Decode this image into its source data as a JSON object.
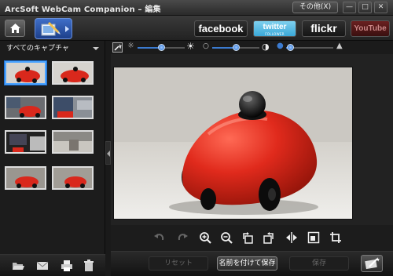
{
  "window": {
    "title": "ArcSoft WebCam Companion  –  編集",
    "other_button": "その他(X)",
    "minimize": "—",
    "maximize": "□",
    "close": "✕"
  },
  "toolbar": {
    "home_icon": "home-icon",
    "capture_icon": "capture-edit-icon",
    "share": {
      "facebook": "facebook",
      "twitter": "twitter",
      "twitter_sub": "FOLLOWER",
      "flickr": "flickr",
      "youtube": "YouTube"
    }
  },
  "left_panel": {
    "filter_label": "すべてのキャプチャ",
    "thumbnails": [
      {
        "id": 1,
        "selected": true
      },
      {
        "id": 2,
        "selected": false
      },
      {
        "id": 3,
        "selected": false
      },
      {
        "id": 4,
        "selected": false
      },
      {
        "id": 5,
        "selected": false
      },
      {
        "id": 6,
        "selected": false
      },
      {
        "id": 7,
        "selected": false
      },
      {
        "id": 8,
        "selected": false
      }
    ],
    "footer_icons": [
      "open-folder-icon",
      "email-icon",
      "print-icon",
      "trash-icon"
    ]
  },
  "adjust_bar": {
    "brightness_level": 0.55,
    "contrast_level": 0.55,
    "saturation_level": 0.1
  },
  "edit_tools": [
    "undo-icon",
    "redo-icon",
    "zoom-in-icon",
    "zoom-out-icon",
    "rotate-left-icon",
    "rotate-right-icon",
    "flip-icon",
    "fit-icon",
    "crop-icon"
  ],
  "bottom_bar": {
    "reset_label": "リセット",
    "save_as_label": "名前を付けて保存",
    "save_label": "保存"
  },
  "colors": {
    "accent": "#3b7bd0",
    "car_red": "#d9281c",
    "background": "#1a1a1a"
  }
}
